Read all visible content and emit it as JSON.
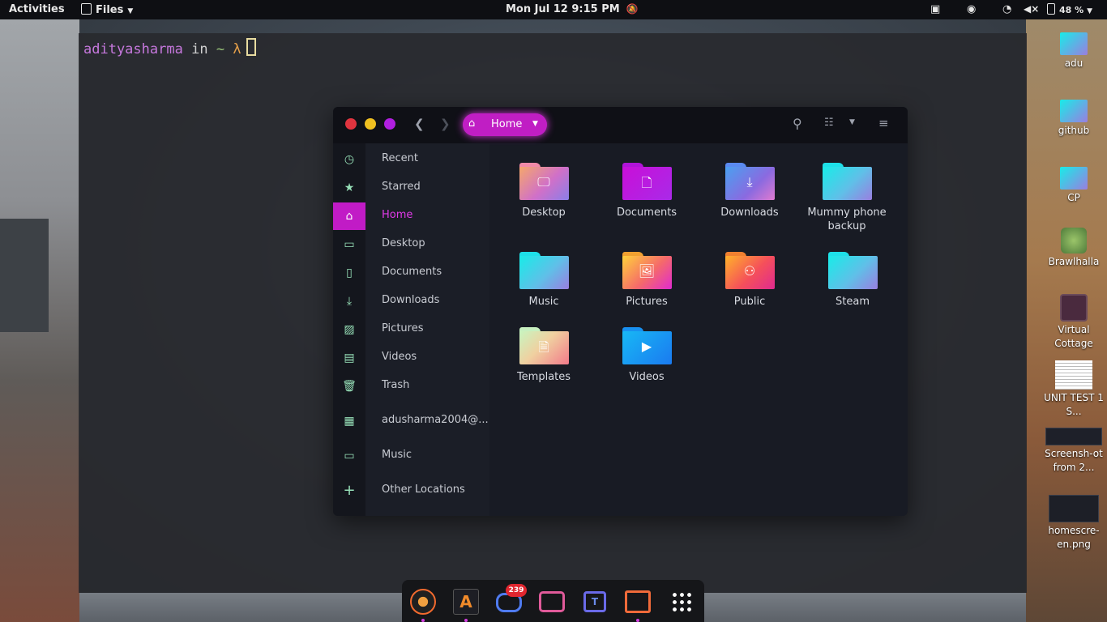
{
  "topbar": {
    "activities": "Activities",
    "app_menu": "Files",
    "datetime": "Mon Jul 12   9:15 PM",
    "battery": "48 %"
  },
  "terminal": {
    "user": "adityasharma",
    "in": "in",
    "dir": "~",
    "prompt_symbol": "λ"
  },
  "files_window": {
    "path_label": "Home",
    "sidebar": [
      {
        "label": "Recent",
        "icon": "clock-icon"
      },
      {
        "label": "Starred",
        "icon": "star-icon"
      },
      {
        "label": "Home",
        "icon": "home-icon",
        "active": true
      },
      {
        "label": "Desktop",
        "icon": "desktop-icon"
      },
      {
        "label": "Documents",
        "icon": "document-icon"
      },
      {
        "label": "Downloads",
        "icon": "download-icon"
      },
      {
        "label": "Pictures",
        "icon": "picture-icon"
      },
      {
        "label": "Videos",
        "icon": "film-icon"
      },
      {
        "label": "Trash",
        "icon": "trash-icon"
      },
      {
        "label": "adusharma2004@...",
        "icon": "drive-icon"
      },
      {
        "label": "Music",
        "icon": "folder-icon"
      },
      {
        "label": "Other Locations",
        "icon": "plus-icon"
      }
    ],
    "folders": [
      {
        "name": "Desktop"
      },
      {
        "name": "Documents"
      },
      {
        "name": "Downloads"
      },
      {
        "name": "Mummy phone backup"
      },
      {
        "name": "Music"
      },
      {
        "name": "Pictures"
      },
      {
        "name": "Public"
      },
      {
        "name": "Steam"
      },
      {
        "name": "Templates"
      },
      {
        "name": "Videos"
      }
    ]
  },
  "desktop_icons": [
    {
      "label": "adu"
    },
    {
      "label": "github"
    },
    {
      "label": "CP"
    },
    {
      "label": "Brawlhalla"
    },
    {
      "label": "Virtual Cottage"
    },
    {
      "label": "UNIT TEST 1 S..."
    },
    {
      "label": "Screensh-ot from 2..."
    },
    {
      "label": "homescre-en.png"
    }
  ],
  "dock": {
    "discord_badge": "239"
  },
  "colors": {
    "accent": "#c11bc6",
    "sidebar_icon": "#97e0b8",
    "close": "#e0343f",
    "minimize": "#f0c020",
    "maximize": "#b01fe0"
  }
}
